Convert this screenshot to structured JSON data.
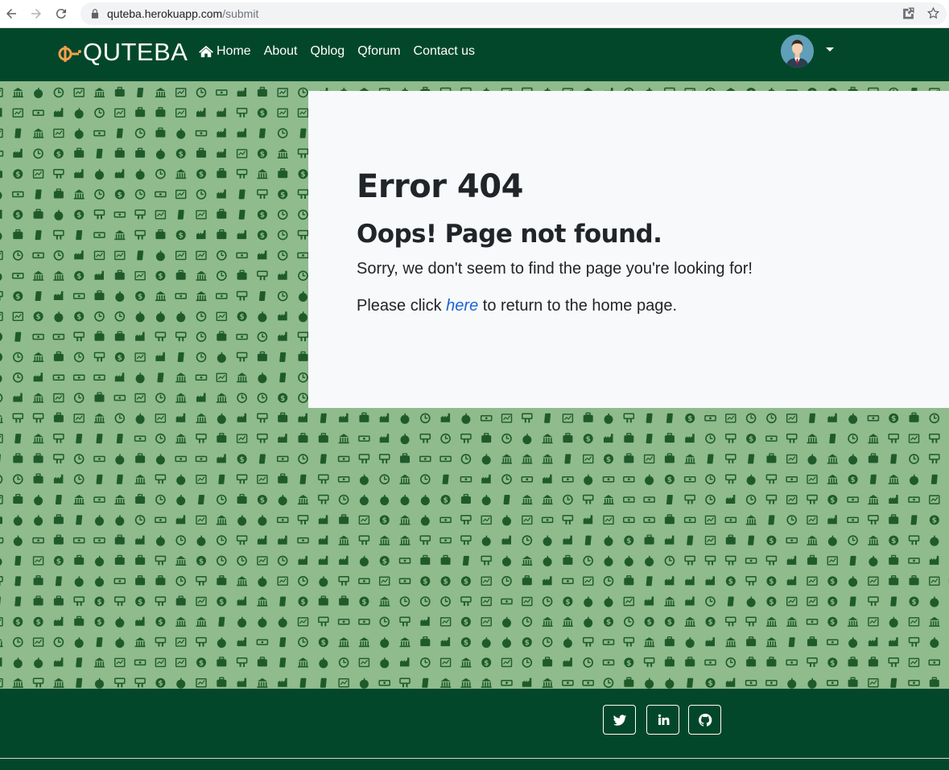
{
  "browser": {
    "url_host": "quteba.herokuapp.com",
    "url_path": "/submit"
  },
  "navbar": {
    "brand": "QUTEBA",
    "links": [
      "Home",
      "About",
      "Qblog",
      "Qforum",
      "Contact us"
    ]
  },
  "error": {
    "title": "Error 404",
    "subtitle": "Oops! Page not found.",
    "message": "Sorry, we don't seem to find the page you're looking for!",
    "return_prefix": "Please click",
    "return_link": "here",
    "return_suffix": "to return to the home page."
  },
  "footer": {
    "social": [
      "twitter-icon",
      "linkedin-icon",
      "github-icon"
    ]
  },
  "colors": {
    "nav_bg": "#03472b",
    "pattern_bg": "#8fbb8d",
    "pattern_fg": "#1f5a2b",
    "brand_mark": "#f5a04a",
    "link": "#1a62d6"
  }
}
